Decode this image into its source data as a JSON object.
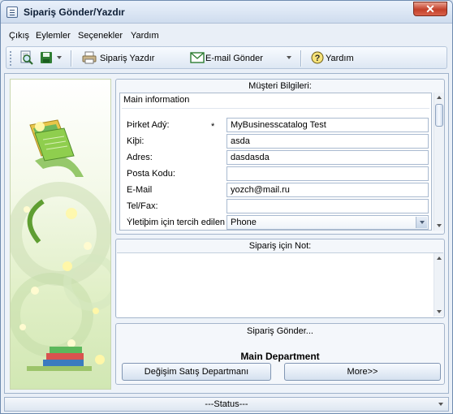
{
  "window": {
    "title": "Sipariş Gönder/Yazdır",
    "close_glyph": "✕"
  },
  "menu": [
    "Çıkış",
    "Eylemler",
    "Seçenekler",
    "Yardım"
  ],
  "toolbar": {
    "print_label": "Sipariş Yazdır",
    "email_label": "E-mail Gönder",
    "help_label": "Yardım",
    "icons": [
      "print-preview-icon",
      "save-icon",
      "printer-icon",
      "envelope-icon",
      "help-icon"
    ]
  },
  "customer": {
    "group_title": "Müşteri Bilgileri:",
    "section_title": "Main information",
    "required_mark": "*",
    "fields": [
      {
        "label": "Þirket Adý:",
        "value": "MyBusinesscatalog Test",
        "required": true
      },
      {
        "label": "Kiþi:",
        "value": "asda"
      },
      {
        "label": "Adres:",
        "value": "dasdasda"
      },
      {
        "label": "Posta Kodu:",
        "value": ""
      },
      {
        "label": "E-Mail",
        "value": "yozch@mail.ru"
      },
      {
        "label": "Tel/Fax:",
        "value": ""
      },
      {
        "label": "Ýletiþim için tercih edilen Yol",
        "value": "Phone",
        "combo": true
      }
    ]
  },
  "note": {
    "group_title": "Sipariş için Not:",
    "value": ""
  },
  "send": {
    "group_title": "Sipariş Gönder...",
    "department": "Main Department",
    "change_button": "Değişim Satış Departmanı",
    "more_button": "More>>"
  },
  "status": {
    "text": "---Status---"
  },
  "colors": {
    "accent": "#c3402a",
    "frame": "#6f8bb0",
    "panel": "#f4f7fb"
  }
}
